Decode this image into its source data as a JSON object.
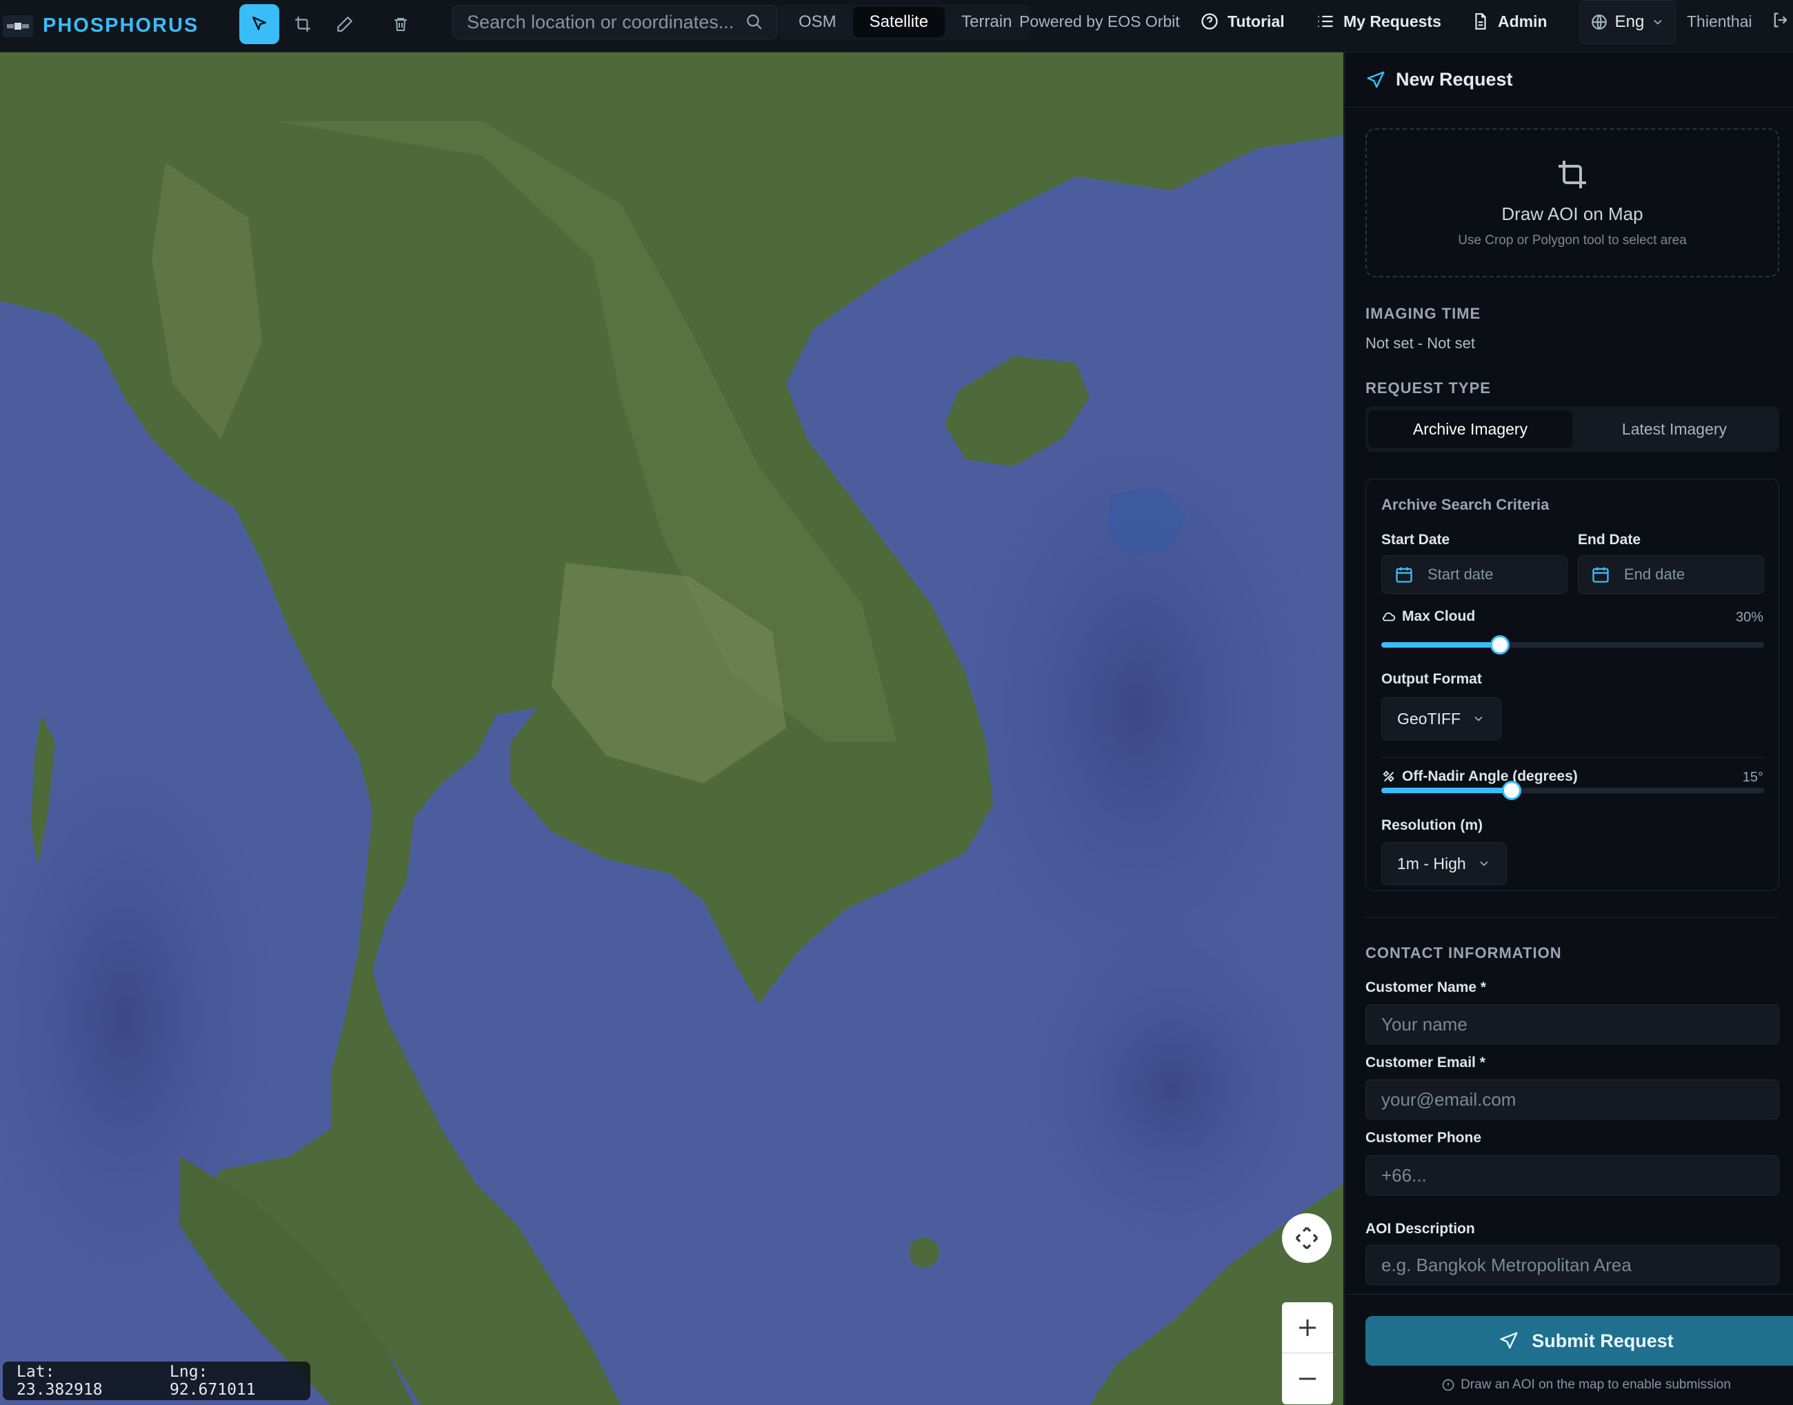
{
  "app": {
    "name": "PHOSPHORUS",
    "powered_by": "Powered by EOS Orbit",
    "user": "Thienthai"
  },
  "toolbar": {
    "tools": [
      "pointer-tool",
      "crop-tool",
      "pencil-tool",
      "trash-tool"
    ],
    "active_tool": "pointer-tool"
  },
  "search": {
    "placeholder": "Search location or coordinates..."
  },
  "map_layers": {
    "options": [
      "OSM",
      "Satellite",
      "Terrain"
    ],
    "active": "Satellite"
  },
  "nav": {
    "tutorial": "Tutorial",
    "my_requests": "My Requests",
    "admin": "Admin",
    "language": "Eng"
  },
  "map": {
    "lat_label": "Lat: 23.382918",
    "lng_label": "Lng: 92.671011",
    "zoom_in": "+",
    "zoom_out": "−"
  },
  "panel": {
    "title": "New Request",
    "aoi": {
      "title": "Draw AOI on Map",
      "subtitle": "Use Crop or Polygon tool to select area"
    },
    "imaging_time": {
      "label": "IMAGING TIME",
      "value": "Not set - Not set"
    },
    "request_type": {
      "label": "REQUEST TYPE",
      "options": [
        "Archive Imagery",
        "Latest Imagery"
      ],
      "active": "Archive Imagery"
    },
    "criteria": {
      "title": "Archive Search Criteria",
      "start_date_label": "Start Date",
      "start_date_placeholder": "Start date",
      "end_date_label": "End Date",
      "end_date_placeholder": "End date",
      "max_cloud_label": "Max Cloud",
      "max_cloud_value": "30%",
      "max_cloud_fraction": 0.31,
      "output_format_label": "Output Format",
      "output_format_value": "GeoTIFF",
      "off_nadir_label": "Off-Nadir Angle (degrees)",
      "off_nadir_value": "15°",
      "off_nadir_fraction": 0.34,
      "resolution_label": "Resolution (m)",
      "resolution_value": "1m - High"
    },
    "contact": {
      "label": "CONTACT INFORMATION",
      "name_label": "Customer Name *",
      "name_placeholder": "Your name",
      "email_label": "Customer Email *",
      "email_placeholder": "your@email.com",
      "phone_label": "Customer Phone",
      "phone_placeholder": "+66...",
      "aoi_desc_label": "AOI Description",
      "aoi_desc_placeholder": "e.g. Bangkok Metropolitan Area"
    },
    "submit_label": "Submit Request",
    "submit_hint": "Draw an AOI on the map to enable submission"
  },
  "colors": {
    "accent": "#38bdf8",
    "submit": "#1f6f8f",
    "panel_bg": "#0b0f15",
    "ocean": "#4c5d9e",
    "land": "#4e6a3a"
  }
}
